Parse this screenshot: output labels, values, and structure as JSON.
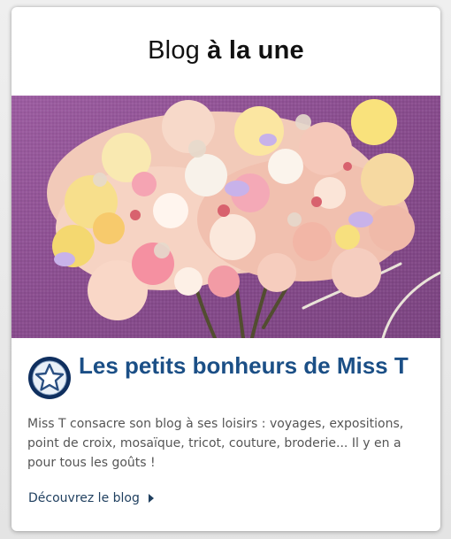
{
  "widget": {
    "title_regular": "Blog",
    "title_bold": "à la une"
  },
  "featured_image": {
    "subject": "embroidered-ribbon-flower-tree"
  },
  "blog": {
    "badge_icon": "star-icon",
    "name": "Les petits bonheurs de Miss T",
    "description": "Miss T consacre son blog à ses loisirs : voyages, expositions, point de croix, mosaïque, tricot, couture, broderie... Il y en a pour tous les goûts !",
    "link_label": "Découvrez le blog"
  },
  "colors": {
    "accent": "#1b4f86",
    "text": "#555555",
    "link": "#1f3f5f",
    "badge": "#0f2f5f"
  }
}
